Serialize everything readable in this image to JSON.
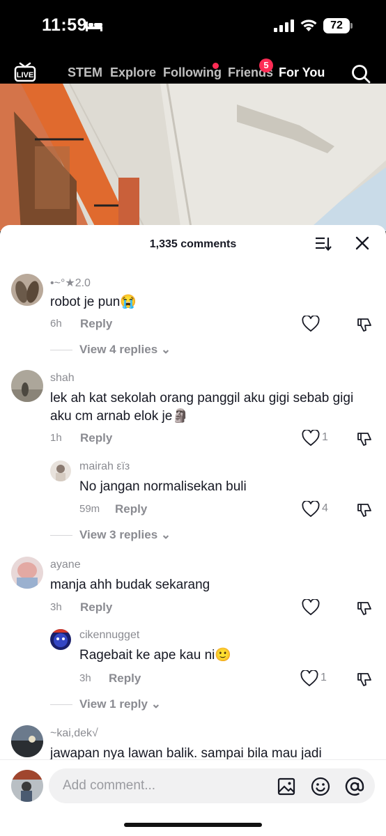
{
  "status_bar": {
    "time": "11:59",
    "battery": "72"
  },
  "nav": {
    "live_label": "LIVE",
    "tabs": [
      "STEM",
      "Explore",
      "Following",
      "Friends",
      "For You"
    ],
    "friends_badge": "5",
    "active_tab": "For You"
  },
  "sheet": {
    "comment_count": "1,335 comments",
    "comments": [
      {
        "user": "•~°★2.0",
        "text": "robot je pun😭",
        "time": "6h",
        "reply": "Reply",
        "likes": "",
        "view_replies": "View 4 replies"
      },
      {
        "user": "shah",
        "text": "lek ah kat sekolah orang panggil aku gigi sebab gigi aku cm arnab elok je🗿",
        "time": "1h",
        "reply": "Reply",
        "likes": "1"
      },
      {
        "user": "mairah εïз",
        "text": "No jangan normalisekan buli",
        "time": "59m",
        "reply": "Reply",
        "likes": "4",
        "view_replies": "View 3 replies"
      },
      {
        "user": "ayane",
        "text": "manja ahh budak sekarang",
        "time": "3h",
        "reply": "Reply",
        "likes": ""
      },
      {
        "user": "cikennugget",
        "text": "Ragebait ke ape kau ni🙂",
        "time": "3h",
        "reply": "Reply",
        "likes": "1",
        "view_replies": "View 1 reply"
      },
      {
        "user": "~kai,dek√",
        "text": "jawapan nya lawan balik. sampai bila mau jadi"
      }
    ]
  },
  "composer": {
    "placeholder": "Add comment..."
  },
  "colors": {
    "accent": "#fe2c55",
    "muted": "#8a8b91",
    "text": "#161823"
  }
}
